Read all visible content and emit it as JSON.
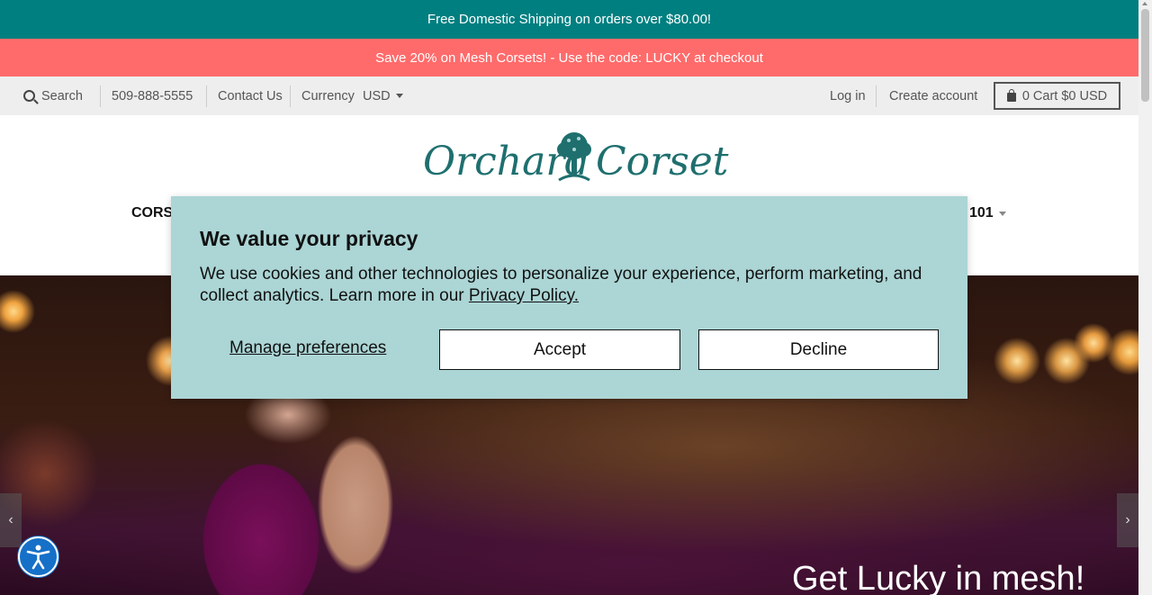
{
  "announcements": {
    "shipping": "Free Domestic Shipping on orders over $80.00!",
    "promo": "Save 20% on Mesh Corsets! - Use the code: LUCKY at checkout"
  },
  "utility_bar": {
    "search_label": "Search",
    "phone": "509-888-5555",
    "contact": "Contact Us",
    "currency_label": "Currency",
    "currency_value": "USD",
    "login": "Log in",
    "create_account": "Create account",
    "cart_label": "0 Cart $0 USD"
  },
  "logo": {
    "left": "Orchard",
    "right": "Corset"
  },
  "nav": {
    "left_item": "CORS",
    "right_item": "101"
  },
  "hero": {
    "heading": "Get Lucky in mesh!",
    "prev": "‹",
    "next": "›"
  },
  "privacy_modal": {
    "title": "We value your privacy",
    "body": "We use cookies and other technologies to personalize your experience, perform marketing, and collect analytics. Learn more in our ",
    "policy_link": "Privacy Policy.",
    "manage": "Manage preferences",
    "accept": "Accept",
    "decline": "Decline"
  },
  "colors": {
    "shipping_bar": "#007f80",
    "promo_bar": "#ff6b6b",
    "modal_bg": "#acd5d5",
    "logo_teal": "#1f6f6f",
    "a11y_blue": "#1670c8"
  },
  "icons": [
    "search-icon",
    "caret-down-icon",
    "shopping-bag-icon",
    "tree-icon",
    "chevron-left-icon",
    "chevron-right-icon",
    "accessibility-icon"
  ]
}
